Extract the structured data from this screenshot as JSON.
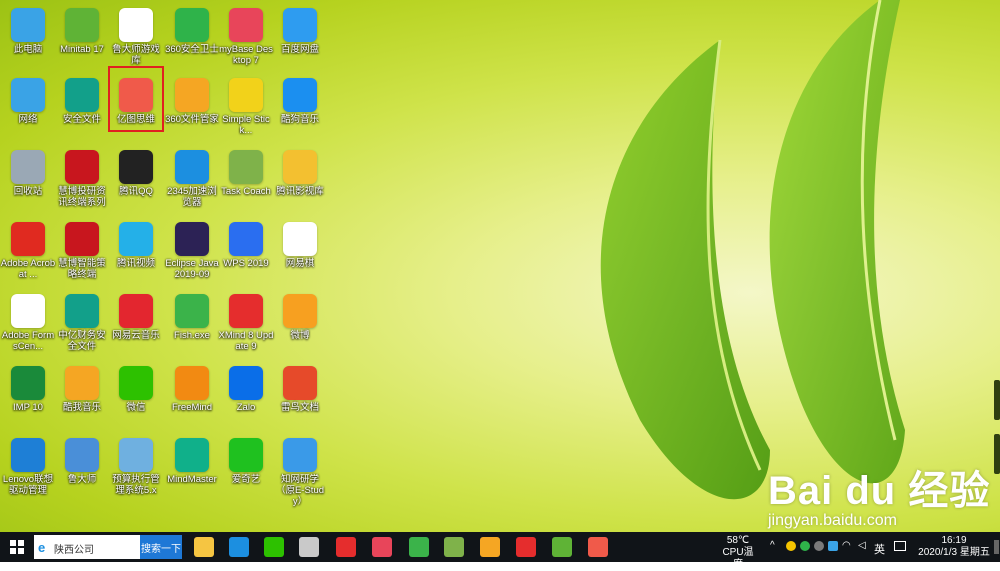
{
  "desktop_icons": [
    {
      "label": "此电脑",
      "icon": "computer-icon",
      "color": "#3aa3e6"
    },
    {
      "label": "Minitab 17",
      "icon": "minitab-icon",
      "color": "#5fb336"
    },
    {
      "label": "鲁大师游戏库",
      "icon": "gamepad-icon",
      "color": "#ffffff"
    },
    {
      "label": "360安全卫士",
      "icon": "360-guard-icon",
      "color": "#2fb34a"
    },
    {
      "label": "myBase Desktop 7",
      "icon": "mybase-icon",
      "color": "#e8455a"
    },
    {
      "label": "百度网盘",
      "icon": "baidu-netdisk-icon",
      "color": "#2e9cf0"
    },
    {
      "label": "网络",
      "icon": "network-icon",
      "color": "#3aa3e6"
    },
    {
      "label": "安全文件",
      "icon": "secure-file-icon",
      "color": "#12a08a"
    },
    {
      "label": "亿图思维",
      "icon": "edraw-mind-icon",
      "color": "#f05a4a"
    },
    {
      "label": "360文件管家",
      "icon": "360-file-icon",
      "color": "#f5a623"
    },
    {
      "label": "Simple Stick...",
      "icon": "sticky-note-icon",
      "color": "#f2d21a"
    },
    {
      "label": "酷狗音乐",
      "icon": "kugou-icon",
      "color": "#1b8ff0"
    },
    {
      "label": "回收站",
      "icon": "recycle-bin-icon",
      "color": "#9aa8b5"
    },
    {
      "label": "慧博投研资讯终端系列",
      "icon": "huibo-icon",
      "color": "#c8161e"
    },
    {
      "label": "腾讯QQ",
      "icon": "qq-icon",
      "color": "#222222"
    },
    {
      "label": "2345加速浏览器",
      "icon": "ie-icon",
      "color": "#1c8fe0"
    },
    {
      "label": "Task Coach",
      "icon": "task-coach-icon",
      "color": "#7fb24a"
    },
    {
      "label": "腾讯影视库",
      "icon": "video-folder-icon",
      "color": "#f3c030"
    },
    {
      "label": "Adobe Acrobat ...",
      "icon": "acrobat-icon",
      "color": "#e02a20"
    },
    {
      "label": "慧博智能策略终端",
      "icon": "huibo-strategy-icon",
      "color": "#c8161e"
    },
    {
      "label": "腾讯视频",
      "icon": "tencent-video-icon",
      "color": "#24b0e8"
    },
    {
      "label": "Eclipse Java 2019-09",
      "icon": "eclipse-icon",
      "color": "#2c2255"
    },
    {
      "label": "WPS 2019",
      "icon": "wps-icon",
      "color": "#2a6ef0"
    },
    {
      "label": "网易棋",
      "icon": "cards-icon",
      "color": "#ffffff"
    },
    {
      "label": "Adobe FormsCen...",
      "icon": "forms-central-icon",
      "color": "#ffffff"
    },
    {
      "label": "中亿财务安全文件",
      "icon": "finance-secure-icon",
      "color": "#12a08a"
    },
    {
      "label": "网易云音乐",
      "icon": "netease-music-icon",
      "color": "#e3262f"
    },
    {
      "label": "Fish.exe",
      "icon": "fish-icon",
      "color": "#3bb34a"
    },
    {
      "label": "XMind 8 Update 9",
      "icon": "xmind-icon",
      "color": "#e52d2d"
    },
    {
      "label": "微博",
      "icon": "weibo-icon",
      "color": "#f7a020"
    },
    {
      "label": "IMP 10",
      "icon": "imp-icon",
      "color": "#1a8a3a"
    },
    {
      "label": "酷我音乐",
      "icon": "kuwo-icon",
      "color": "#f5a623"
    },
    {
      "label": "微信",
      "icon": "wechat-icon",
      "color": "#2dc100"
    },
    {
      "label": "FreeMind",
      "icon": "freemind-icon",
      "color": "#f28a12"
    },
    {
      "label": "Zalo",
      "icon": "zalo-icon",
      "color": "#0a6ee8"
    },
    {
      "label": "雷鸟文档",
      "icon": "house-icon",
      "color": "#e64a2a"
    },
    {
      "label": "Lenovo联想驱动管理",
      "icon": "lenovo-driver-icon",
      "color": "#1e7fd6"
    },
    {
      "label": "鲁大师",
      "icon": "ludashi-icon",
      "color": "#4a8fd8"
    },
    {
      "label": "预算执行管理系统5.x",
      "icon": "budget-icon",
      "color": "#6fb0e0"
    },
    {
      "label": "MindMaster",
      "icon": "mindmaster-icon",
      "color": "#10b08a"
    },
    {
      "label": "爱奇艺",
      "icon": "iqiyi-icon",
      "color": "#1fc11f"
    },
    {
      "label": "知网研学（原E-Study）",
      "icon": "estudy-icon",
      "color": "#3a9ae8"
    }
  ],
  "watermark": {
    "brand": "Bai du 经验",
    "url": "jingyan.baidu.com"
  },
  "taskbar": {
    "search_text": "陕西公司",
    "search_button": "搜索一下",
    "apps": [
      {
        "name": "file-explorer-icon",
        "color": "#f5c542"
      },
      {
        "name": "ie-browser-icon",
        "color": "#1c8fe0"
      },
      {
        "name": "wechat-icon",
        "color": "#2dc100"
      },
      {
        "name": "game-icon",
        "color": "#c9c9c9"
      },
      {
        "name": "xmind-icon",
        "color": "#e52d2d"
      },
      {
        "name": "mybase-icon",
        "color": "#e8455a"
      },
      {
        "name": "fish-icon",
        "color": "#3bb34a"
      },
      {
        "name": "paint-icon",
        "color": "#7fb24a"
      },
      {
        "name": "kuwo-icon",
        "color": "#f5a623"
      },
      {
        "name": "xmind-2-icon",
        "color": "#e52d2d"
      },
      {
        "name": "minitab-icon",
        "color": "#5fb336"
      },
      {
        "name": "edraw-icon",
        "color": "#f05a4a"
      }
    ],
    "temperature": "58℃",
    "temperature_label": "CPU温度",
    "ime": "英",
    "time": "16:19",
    "date": "2020/1/3 星期五"
  }
}
